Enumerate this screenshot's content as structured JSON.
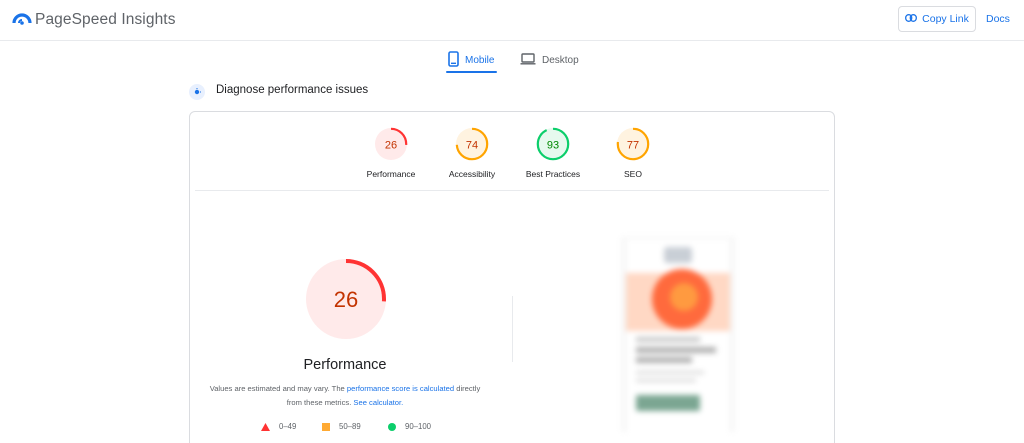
{
  "header": {
    "logo_text": "PageSpeed Insights",
    "copy_link_label": "Copy Link",
    "docs_label": "Docs"
  },
  "tabs": {
    "mobile_label": "Mobile",
    "desktop_label": "Desktop",
    "active": "Mobile"
  },
  "diagnose": {
    "title": "Diagnose performance issues"
  },
  "scores": [
    {
      "label": "Performance",
      "value": "26",
      "score": 26,
      "status": "fail"
    },
    {
      "label": "Accessibility",
      "value": "74",
      "score": 74,
      "status": "average"
    },
    {
      "label": "Best Practices",
      "value": "93",
      "score": 93,
      "status": "pass"
    },
    {
      "label": "SEO",
      "value": "77",
      "score": 77,
      "status": "average"
    }
  ],
  "main": {
    "score_value": "26",
    "score": 26,
    "title": "Performance",
    "desc_part1": "Values are estimated and may vary. The ",
    "desc_link1": "performance score is calculated",
    "desc_part2": " directly from these metrics. ",
    "desc_link2": "See calculator."
  },
  "legend": [
    {
      "range": "0–49",
      "shape": "triangle",
      "color": "#ff3333"
    },
    {
      "range": "50–89",
      "shape": "square",
      "color": "#ffaa33"
    },
    {
      "range": "90–100",
      "shape": "circle",
      "color": "#0cce6b"
    }
  ],
  "colors": {
    "accent": "#1a73e8",
    "fail": "#ff3333",
    "fail_bg": "#ffeaea",
    "fail_text": "#c33300",
    "average": "#ffa400",
    "average_bg": "#fff3e0",
    "average_text": "#c33300",
    "pass": "#0cce6b",
    "pass_bg": "#e6f9ee",
    "pass_text": "#008800"
  },
  "icons": {
    "logo": "pagespeed-gauge-icon",
    "copy_link": "link-icon",
    "mobile": "phone-icon",
    "desktop": "laptop-icon",
    "diagnose": "magnifier-icon"
  }
}
